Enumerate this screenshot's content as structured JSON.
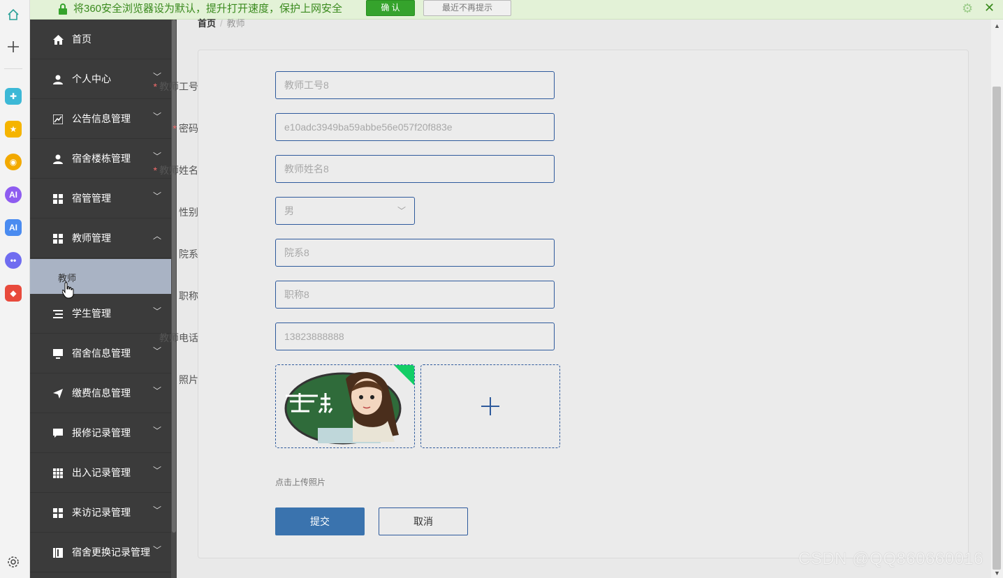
{
  "notify_bar": {
    "message": "将360安全浏览器设为默认，提升打开速度，保护上网安全",
    "confirm_label": "确 认",
    "dismiss_label": "最近不再提示"
  },
  "sidebar": {
    "items": [
      {
        "label": "首页",
        "icon": "home-icon",
        "expandable": false
      },
      {
        "label": "个人中心",
        "icon": "user-icon",
        "expandable": true
      },
      {
        "label": "公告信息管理",
        "icon": "chart-icon",
        "expandable": true
      },
      {
        "label": "宿舍楼栋管理",
        "icon": "user-icon",
        "expandable": true
      },
      {
        "label": "宿管管理",
        "icon": "grid-icon",
        "expandable": true
      },
      {
        "label": "教师管理",
        "icon": "grid-icon",
        "expandable": true,
        "expanded": true
      },
      {
        "label": "学生管理",
        "icon": "list-icon",
        "expandable": true
      },
      {
        "label": "宿舍信息管理",
        "icon": "monitor-icon",
        "expandable": true
      },
      {
        "label": "缴费信息管理",
        "icon": "send-icon",
        "expandable": true
      },
      {
        "label": "报修记录管理",
        "icon": "chat-icon",
        "expandable": true
      },
      {
        "label": "出入记录管理",
        "icon": "table-icon",
        "expandable": true
      },
      {
        "label": "来访记录管理",
        "icon": "grid-icon",
        "expandable": true
      },
      {
        "label": "宿舍更换记录管理",
        "icon": "book-icon",
        "expandable": true
      }
    ],
    "active_sub_item": "教师"
  },
  "breadcrumb": {
    "home": "首页",
    "separator": "/",
    "current": "教师"
  },
  "form": {
    "teacher_id": {
      "label": "教师工号",
      "required": true,
      "placeholder": "教师工号8"
    },
    "password": {
      "label": "密码",
      "required": true,
      "placeholder": "e10adc3949ba59abbe56e057f20f883e"
    },
    "teacher_name": {
      "label": "教师姓名",
      "required": true,
      "placeholder": "教师姓名8"
    },
    "gender": {
      "label": "性别",
      "value": "男"
    },
    "department": {
      "label": "院系",
      "placeholder": "院系8"
    },
    "title": {
      "label": "职称",
      "placeholder": "职称8"
    },
    "phone": {
      "label": "教师电话",
      "placeholder": "13823888888"
    },
    "photo": {
      "label": "照片",
      "hint": "点击上传照片"
    },
    "submit_label": "提交",
    "cancel_label": "取消"
  },
  "watermark": "CSDN @QQ860660016",
  "colors": {
    "sidebar_bg": "#3b3b3b",
    "sidebar_active": "#a9b3c4",
    "primary": "#3a73ae",
    "input_border": "#2e5a9c",
    "required": "#f56c6c",
    "notify_green": "#35a32c"
  }
}
